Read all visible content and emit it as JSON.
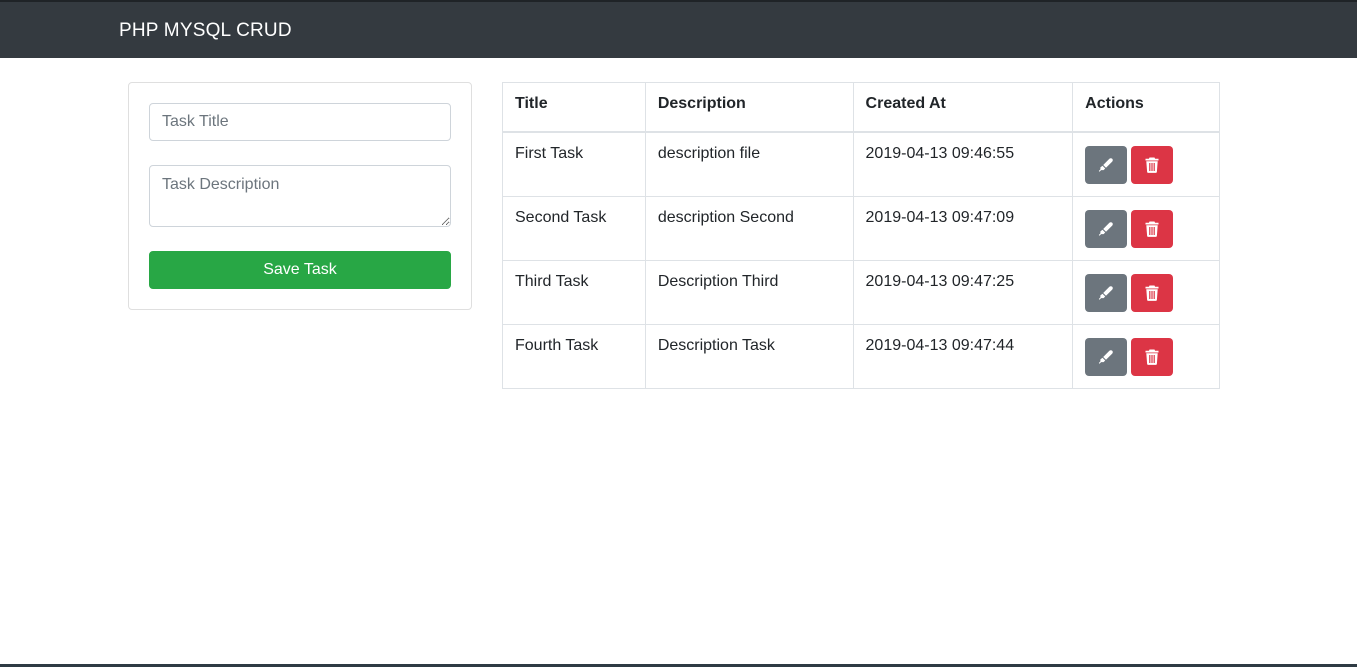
{
  "navbar": {
    "brand": "PHP MYSQL CRUD"
  },
  "form": {
    "title_placeholder": "Task Title",
    "title_value": "",
    "description_placeholder": "Task Description",
    "description_value": "",
    "save_label": "Save Task"
  },
  "table": {
    "headers": {
      "title": "Title",
      "description": "Description",
      "created_at": "Created At",
      "actions": "Actions"
    },
    "rows": [
      {
        "title": "First Task",
        "description": "description file",
        "created_at": "2019-04-13 09:46:55"
      },
      {
        "title": "Second Task",
        "description": "description Second",
        "created_at": "2019-04-13 09:47:09"
      },
      {
        "title": "Third Task",
        "description": "Description Third",
        "created_at": "2019-04-13 09:47:25"
      },
      {
        "title": "Fourth Task",
        "description": "Description Task",
        "created_at": "2019-04-13 09:47:44"
      }
    ],
    "edit_icon": "marker-icon",
    "delete_icon": "trash-icon"
  },
  "colors": {
    "navbar": "#343a40",
    "success": "#28a745",
    "secondary": "#6c757d",
    "danger": "#dc3545"
  }
}
